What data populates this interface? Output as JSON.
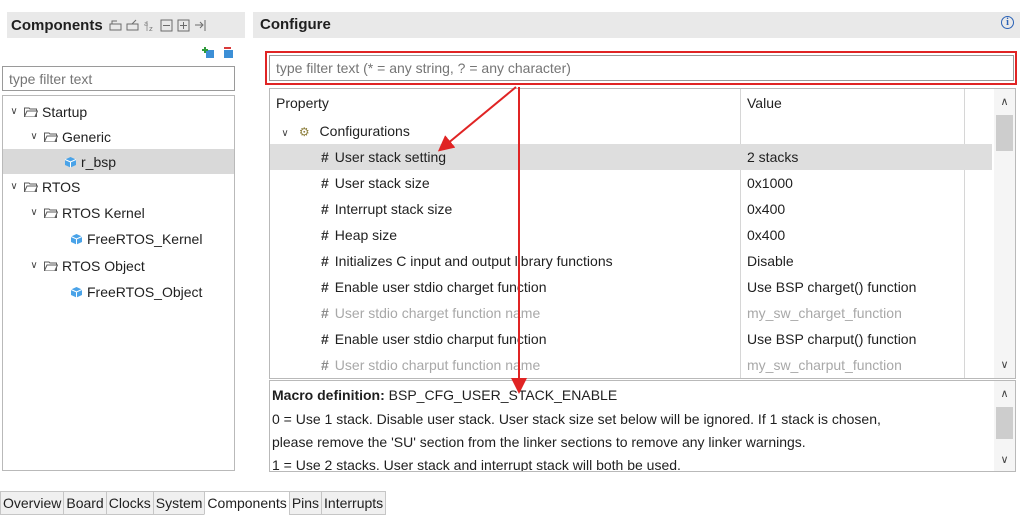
{
  "components_panel": {
    "title": "Components",
    "filter_placeholder": "type filter text",
    "tree": [
      {
        "label": "Startup",
        "type": "folder",
        "expanded": true
      },
      {
        "label": "Generic",
        "type": "folder",
        "expanded": true
      },
      {
        "label": "r_bsp",
        "type": "component",
        "selected": true
      },
      {
        "label": "RTOS",
        "type": "folder",
        "expanded": true
      },
      {
        "label": "RTOS Kernel",
        "type": "folder",
        "expanded": true
      },
      {
        "label": "FreeRTOS_Kernel",
        "type": "component"
      },
      {
        "label": "RTOS Object",
        "type": "folder",
        "expanded": true
      },
      {
        "label": "FreeRTOS_Object",
        "type": "component"
      }
    ]
  },
  "configure_panel": {
    "title": "Configure",
    "filter_placeholder": "type filter text (* = any string, ? = any character)",
    "columns": {
      "property": "Property",
      "value": "Value"
    },
    "group_label": "Configurations",
    "rows": [
      {
        "property": "User stack setting",
        "value": "2 stacks",
        "selected": true
      },
      {
        "property": "User stack size",
        "value": "0x1000"
      },
      {
        "property": "Interrupt stack size",
        "value": "0x400"
      },
      {
        "property": "Heap size",
        "value": "0x400"
      },
      {
        "property": "Initializes C input and output library functions",
        "value": "Disable"
      },
      {
        "property": "Enable user stdio charget function",
        "value": "Use BSP charget() function"
      },
      {
        "property": "User stdio charget function name",
        "value": "my_sw_charget_function",
        "disabled": true
      },
      {
        "property": "Enable user stdio charput function",
        "value": "Use BSP charput() function"
      },
      {
        "property": "User stdio charput function name",
        "value": "my_sw_charput_function",
        "disabled": true
      }
    ],
    "description": {
      "macro_label": "Macro definition:",
      "macro_name": "BSP_CFG_USER_STACK_ENABLE",
      "line1": "0 = Use 1 stack. Disable user stack. User stack size set below will be ignored. If 1 stack is chosen,",
      "line2": "please remove the 'SU' section from the linker sections to remove any linker warnings.",
      "line3": "1 = Use 2 stacks. User stack and interrupt stack will both be used."
    }
  },
  "bottom_tabs": [
    {
      "label": "Overview"
    },
    {
      "label": "Board"
    },
    {
      "label": "Clocks"
    },
    {
      "label": "System"
    },
    {
      "label": "Components",
      "active": true
    },
    {
      "label": "Pins"
    },
    {
      "label": "Interrupts"
    }
  ],
  "colors": {
    "annotation": "#e02424",
    "selected_row": "#dedede",
    "header_bg": "#e9e9e9"
  }
}
